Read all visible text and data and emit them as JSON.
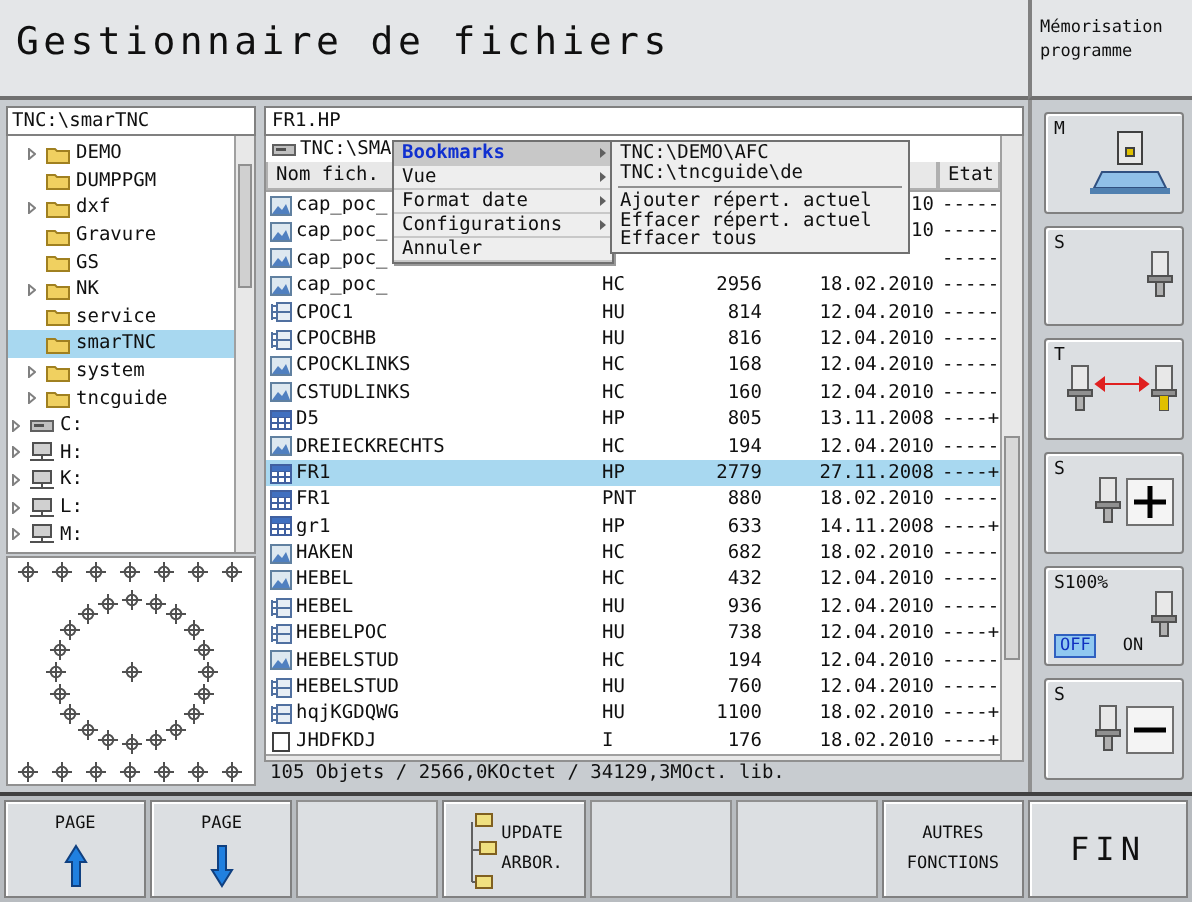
{
  "header": {
    "title": "Gestionnaire de fichiers",
    "mode": [
      "Mémorisation",
      "programme"
    ]
  },
  "tree": {
    "path": "TNC:\\smarTNC",
    "items": [
      {
        "label": "DEMO",
        "kind": "folder",
        "expandable": true,
        "selected": false
      },
      {
        "label": "DUMPPGM",
        "kind": "folder",
        "expandable": false,
        "selected": false
      },
      {
        "label": "dxf",
        "kind": "folder",
        "expandable": true,
        "selected": false
      },
      {
        "label": "Gravure",
        "kind": "folder",
        "expandable": false,
        "selected": false
      },
      {
        "label": "GS",
        "kind": "folder",
        "expandable": false,
        "selected": false
      },
      {
        "label": "NK",
        "kind": "folder",
        "expandable": true,
        "selected": false
      },
      {
        "label": "service",
        "kind": "folder",
        "expandable": false,
        "selected": false
      },
      {
        "label": "smarTNC",
        "kind": "folder",
        "expandable": false,
        "selected": true
      },
      {
        "label": "system",
        "kind": "folder",
        "expandable": true,
        "selected": false
      },
      {
        "label": "tncguide",
        "kind": "folder",
        "expandable": true,
        "selected": false
      },
      {
        "label": "C:",
        "kind": "drive",
        "expandable": true,
        "selected": false
      },
      {
        "label": "H:",
        "kind": "network",
        "expandable": true,
        "selected": false
      },
      {
        "label": "K:",
        "kind": "network",
        "expandable": true,
        "selected": false
      },
      {
        "label": "L:",
        "kind": "network",
        "expandable": true,
        "selected": false
      },
      {
        "label": "M:",
        "kind": "network",
        "expandable": true,
        "selected": false
      }
    ]
  },
  "files": {
    "path": "FR1.HP",
    "filter": "TNC:\\SMA",
    "header": {
      "name": "Nom fich.",
      "state": "Etat"
    },
    "rows": [
      {
        "kind": "image",
        "name": "cap_poc_",
        "date": "10",
        "state": "-----",
        "selected": false
      },
      {
        "kind": "image",
        "name": "cap_poc_",
        "date": "10",
        "state": "-----",
        "selected": false
      },
      {
        "kind": "image",
        "name": "cap_poc_",
        "state": "-----",
        "selected": false
      },
      {
        "kind": "image",
        "name": "cap_poc_",
        "type": "HC",
        "size": "2956",
        "date": "18.02.2010",
        "state": "-----",
        "selected": false
      },
      {
        "kind": "program",
        "name": "CPOC1",
        "type": "HU",
        "size": "814",
        "date": "12.04.2010",
        "state": "-----",
        "selected": false
      },
      {
        "kind": "program",
        "name": "CPOCBHB",
        "type": "HU",
        "size": "816",
        "date": "12.04.2010",
        "state": "-----",
        "selected": false
      },
      {
        "kind": "image",
        "name": "CPOCKLINKS",
        "type": "HC",
        "size": "168",
        "date": "12.04.2010",
        "state": "-----",
        "selected": false
      },
      {
        "kind": "image",
        "name": "CSTUDLINKS",
        "type": "HC",
        "size": "160",
        "date": "12.04.2010",
        "state": "-----",
        "selected": false
      },
      {
        "kind": "table",
        "name": "D5",
        "type": "HP",
        "size": "805",
        "date": "13.11.2008",
        "state": "----+",
        "selected": false
      },
      {
        "kind": "image",
        "name": "DREIECKRECHTS",
        "type": "HC",
        "size": "194",
        "date": "12.04.2010",
        "state": "-----",
        "selected": false
      },
      {
        "kind": "table",
        "name": "FR1",
        "type": "HP",
        "size": "2779",
        "date": "27.11.2008",
        "state": "----+",
        "selected": true
      },
      {
        "kind": "table",
        "name": "FR1",
        "type": "PNT",
        "size": "880",
        "date": "18.02.2010",
        "state": "-----",
        "selected": false
      },
      {
        "kind": "table",
        "name": "gr1",
        "type": "HP",
        "size": "633",
        "date": "14.11.2008",
        "state": "----+",
        "selected": false
      },
      {
        "kind": "image",
        "name": "HAKEN",
        "type": "HC",
        "size": "682",
        "date": "18.02.2010",
        "state": "-----",
        "selected": false
      },
      {
        "kind": "image",
        "name": "HEBEL",
        "type": "HC",
        "size": "432",
        "date": "12.04.2010",
        "state": "-----",
        "selected": false
      },
      {
        "kind": "program",
        "name": "HEBEL",
        "type": "HU",
        "size": "936",
        "date": "12.04.2010",
        "state": "-----",
        "selected": false
      },
      {
        "kind": "program",
        "name": "HEBELPOC",
        "type": "HU",
        "size": "738",
        "date": "12.04.2010",
        "state": "----+",
        "selected": false
      },
      {
        "kind": "image",
        "name": "HEBELSTUD",
        "type": "HC",
        "size": "194",
        "date": "12.04.2010",
        "state": "-----",
        "selected": false
      },
      {
        "kind": "program",
        "name": "HEBELSTUD",
        "type": "HU",
        "size": "760",
        "date": "12.04.2010",
        "state": "-----",
        "selected": false
      },
      {
        "kind": "program",
        "name": "hqjKGDQWG",
        "type": "HU",
        "size": "1100",
        "date": "18.02.2010",
        "state": "----+",
        "selected": false
      },
      {
        "kind": "blank",
        "name": "JHDFKDJ",
        "type": "I",
        "size": "176",
        "date": "18.02.2010",
        "state": "----+",
        "selected": false
      }
    ],
    "status": "105 Objets / 2566,0KOctet / 34129,3MOct. lib."
  },
  "context_menu": {
    "items": [
      {
        "label": "Bookmarks",
        "submenu": true,
        "selected": true
      },
      {
        "label": "Vue",
        "submenu": true,
        "selected": false
      },
      {
        "label": "Format date",
        "submenu": true,
        "selected": false
      },
      {
        "label": "Configurations",
        "submenu": true,
        "selected": false
      },
      {
        "label": "Annuler",
        "submenu": false,
        "selected": false
      }
    ],
    "submenu": [
      {
        "kind": "entry",
        "label": "TNC:\\DEMO\\AFC"
      },
      {
        "kind": "entry",
        "label": "TNC:\\tncguide\\de"
      },
      {
        "kind": "separator"
      },
      {
        "kind": "entry",
        "label": "Ajouter répert. actuel"
      },
      {
        "kind": "entry",
        "label": "Effacer répert. actuel"
      },
      {
        "kind": "entry",
        "label": "Effacer tous"
      }
    ]
  },
  "side_keys": [
    {
      "kind": "machine",
      "label": "M"
    },
    {
      "kind": "spindle",
      "label": "S"
    },
    {
      "kind": "tool_change",
      "label": "T"
    },
    {
      "kind": "spindle_plus",
      "label": "S"
    },
    {
      "kind": "override",
      "label": "S100%",
      "options": [
        {
          "label": "OFF",
          "selected": true
        },
        {
          "label": "ON",
          "selected": false
        }
      ]
    },
    {
      "kind": "spindle_minus",
      "label": "S"
    }
  ],
  "softkeys": [
    {
      "kind": "page_up",
      "lines": [
        "PAGE"
      ]
    },
    {
      "kind": "page_down",
      "lines": [
        "PAGE"
      ]
    },
    {
      "kind": "blank"
    },
    {
      "kind": "tree",
      "lines": [
        "UPDATE",
        "ARBOR."
      ]
    },
    {
      "kind": "blank"
    },
    {
      "kind": "blank"
    },
    {
      "kind": "text",
      "lines": [
        "AUTRES",
        "FONCTIONS"
      ]
    },
    {
      "kind": "end",
      "lines": [
        "FIN"
      ]
    }
  ]
}
